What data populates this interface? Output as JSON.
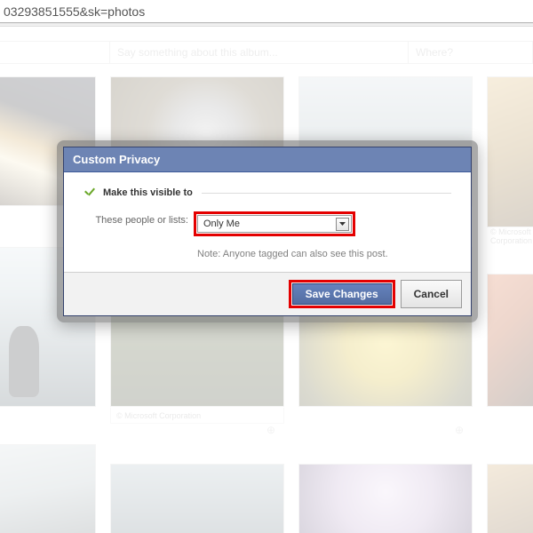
{
  "browser": {
    "url_fragment": "03293851555&sk=photos"
  },
  "composer": {
    "placeholder": "Say something about this album...",
    "where": "Where?"
  },
  "captions": {
    "ms1": "© Microsoft Corporation",
    "ms2": "© Microsoft Corporation"
  },
  "modal": {
    "title": "Custom Privacy",
    "section_heading": "Make this visible to",
    "field_label": "These people or lists:",
    "select_value": "Only Me",
    "note": "Note: Anyone tagged can also see this post.",
    "save_label": "Save Changes",
    "cancel_label": "Cancel"
  }
}
